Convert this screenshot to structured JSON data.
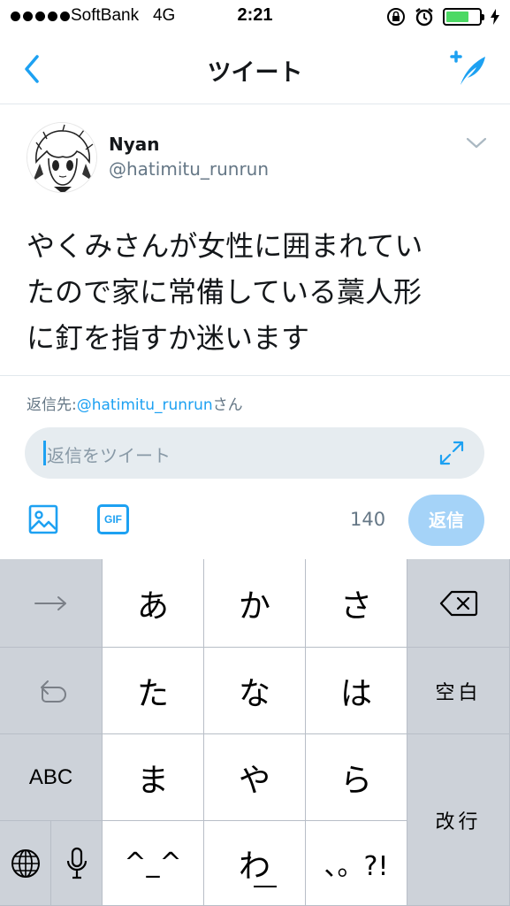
{
  "status": {
    "carrier": "SoftBank",
    "network": "4G",
    "time": "2:21",
    "battery_level": 0.7
  },
  "nav": {
    "title": "ツイート"
  },
  "tweet": {
    "author_name": "Nyan",
    "author_handle": "@hatimitu_runrun",
    "text_lines": [
      "やくみさんが女性に囲まれてい",
      "たので家に常備している藁人形",
      "に釘を指すか迷います"
    ]
  },
  "reply": {
    "prefix": "返信先:",
    "mention": "@hatimitu_runrun",
    "suffix": "さん",
    "placeholder": "返信をツイート",
    "char_count": "140",
    "submit_label": "返信",
    "gif_label": "GIF"
  },
  "colors": {
    "accent": "#1da1f2",
    "reply_button_disabled": "#a5d3f8",
    "battery_fill": "#4cd964"
  },
  "keyboard": {
    "row1": [
      "あ",
      "か",
      "さ"
    ],
    "row2": [
      "た",
      "な",
      "は"
    ],
    "row3": [
      "ま",
      "や",
      "ら"
    ],
    "row4": [
      "^_^",
      "わ",
      "、。?!"
    ],
    "space_label": "空白",
    "return_label": "改行",
    "abc_label": "ABC",
    "icons": {
      "next": "arrow-right-icon",
      "undo": "undo-icon",
      "delete": "backspace-icon",
      "globe": "globe-icon",
      "mic": "microphone-icon"
    }
  }
}
